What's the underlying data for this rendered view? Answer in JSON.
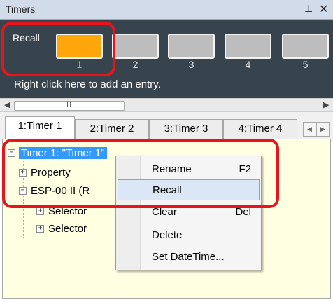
{
  "window": {
    "title": "Timers",
    "pin_icon": "pin-icon",
    "close_icon": "close-icon"
  },
  "recall_panel": {
    "label": "Recall",
    "slots": [
      {
        "num": "1",
        "active": true
      },
      {
        "num": "2",
        "active": false
      },
      {
        "num": "3",
        "active": false
      },
      {
        "num": "4",
        "active": false
      },
      {
        "num": "5",
        "active": false
      }
    ],
    "hint": "Right click here to add an entry.",
    "active_color": "#ffa60a",
    "panel_color": "#38444d"
  },
  "scrollbar": {
    "grip": "III"
  },
  "tabs": [
    {
      "label": "1:Timer 1",
      "active": true
    },
    {
      "label": "2:Timer 2",
      "active": false
    },
    {
      "label": "3:Timer 3",
      "active": false
    },
    {
      "label": "4:Timer 4",
      "active": false
    }
  ],
  "tree": {
    "root": "Timer 1: \"Timer 1\"",
    "items": [
      {
        "label": "Property"
      },
      {
        "label": "ESP-00 II (R"
      },
      {
        "label": "Selector"
      },
      {
        "label": "Selector"
      }
    ]
  },
  "context_menu": {
    "items": [
      {
        "label": "Rename",
        "shortcut": "F2"
      },
      {
        "label": "Recall",
        "shortcut": ""
      },
      {
        "label": "Clear",
        "shortcut": "Del"
      },
      {
        "label": "Delete",
        "shortcut": ""
      },
      {
        "label": "Set DateTime...",
        "shortcut": ""
      }
    ],
    "highlighted": "Recall"
  },
  "annotation_color": "#e8141c"
}
